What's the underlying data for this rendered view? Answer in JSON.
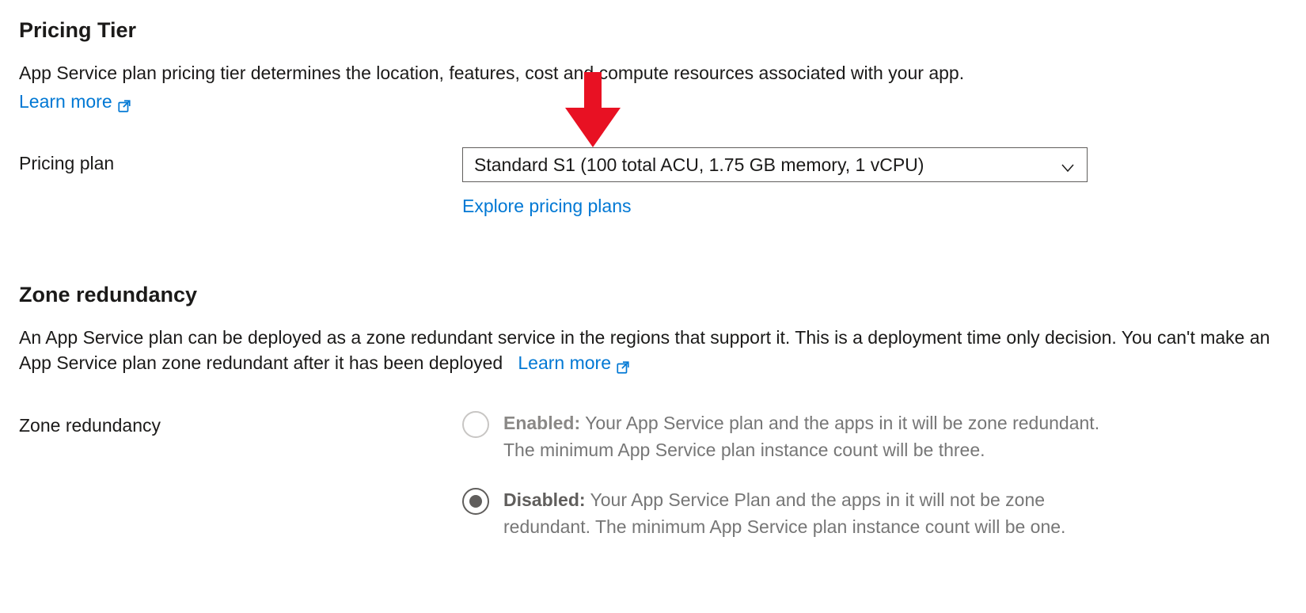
{
  "pricingTier": {
    "heading": "Pricing Tier",
    "description": "App Service plan pricing tier determines the location, features, cost and compute resources associated with your app.",
    "learnMore": "Learn more",
    "planLabel": "Pricing plan",
    "planValue": "Standard S1 (100 total ACU, 1.75 GB memory, 1 vCPU)",
    "exploreLink": "Explore pricing plans"
  },
  "zoneRedundancy": {
    "heading": "Zone redundancy",
    "description": "An App Service plan can be deployed as a zone redundant service in the regions that support it. This is a deployment time only decision. You can't make an App Service plan zone redundant after it has been deployed",
    "learnMore": "Learn more",
    "fieldLabel": "Zone redundancy",
    "options": {
      "enabled": {
        "label": "Enabled:",
        "desc": " Your App Service plan and the apps in it will be zone redundant. The minimum App Service plan instance count will be three."
      },
      "disabled": {
        "label": "Disabled:",
        "desc": " Your App Service Plan and the apps in it will not be zone redundant. The minimum App Service plan instance count will be one."
      }
    }
  }
}
